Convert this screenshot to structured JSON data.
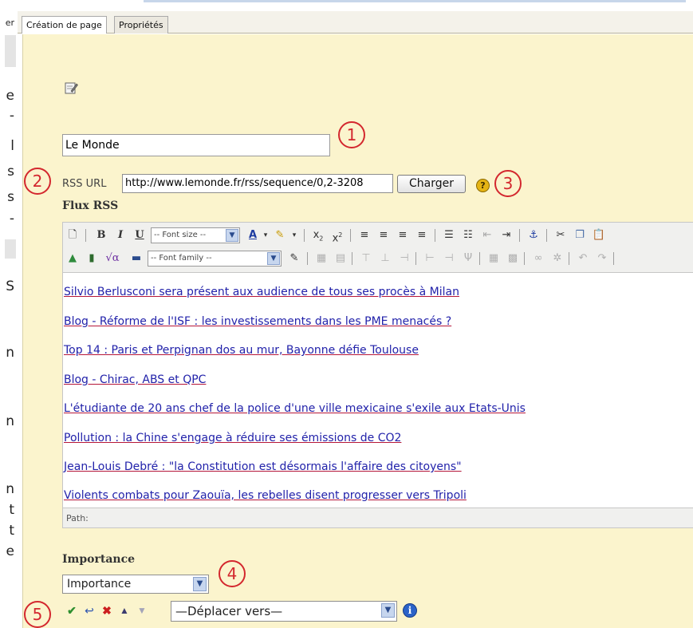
{
  "tabs": [
    {
      "label": "Création de page",
      "active": true
    },
    {
      "label": "Propriétés",
      "active": false
    }
  ],
  "left_fragment": {
    "top_tab": "er",
    "chars": [
      "e",
      "-",
      "l",
      "s",
      "s",
      "-",
      "S",
      "n",
      "n",
      "n",
      "t",
      "t",
      "e"
    ]
  },
  "page_title_value": "Le Monde",
  "rss": {
    "label": "RSS URL",
    "url_value": "http://www.lemonde.fr/rss/sequence/0,2-3208",
    "load_button": "Charger"
  },
  "flux_label": "Flux RSS",
  "toolbar": {
    "font_size_placeholder": "-- Font size --",
    "font_family_placeholder": "-- Font family --"
  },
  "feed_items": [
    "Silvio Berlusconi sera présent aux audience de tous ses procès à Milan",
    "Blog - Réforme de l'ISF : les investissements dans les PME menacés ?",
    "Top 14 : Paris et Perpignan dos au mur, Bayonne défie Toulouse",
    "Blog - Chirac, ABS et QPC",
    "L'étudiante de 20 ans chef de la police d'une ville mexicaine s'exile aux Etats-Unis",
    "Pollution : la Chine s'engage à réduire ses émissions de CO2",
    "Jean-Louis Debré : \"la Constitution est désormais l'affaire des citoyens\"",
    "Violents combats pour Zaouïa, les rebelles disent progresser vers Tripoli"
  ],
  "path_label": "Path:",
  "importance": {
    "label": "Importance",
    "selected": "Importance"
  },
  "move": {
    "selected": "—Déplacer vers—"
  },
  "annotations": [
    "1",
    "2",
    "3",
    "4",
    "5"
  ],
  "colors": {
    "panel_bg": "#fbf4cd",
    "annotation_red": "#d3272e",
    "link_blue": "#2222aa",
    "link_underline": "#b5173a"
  }
}
